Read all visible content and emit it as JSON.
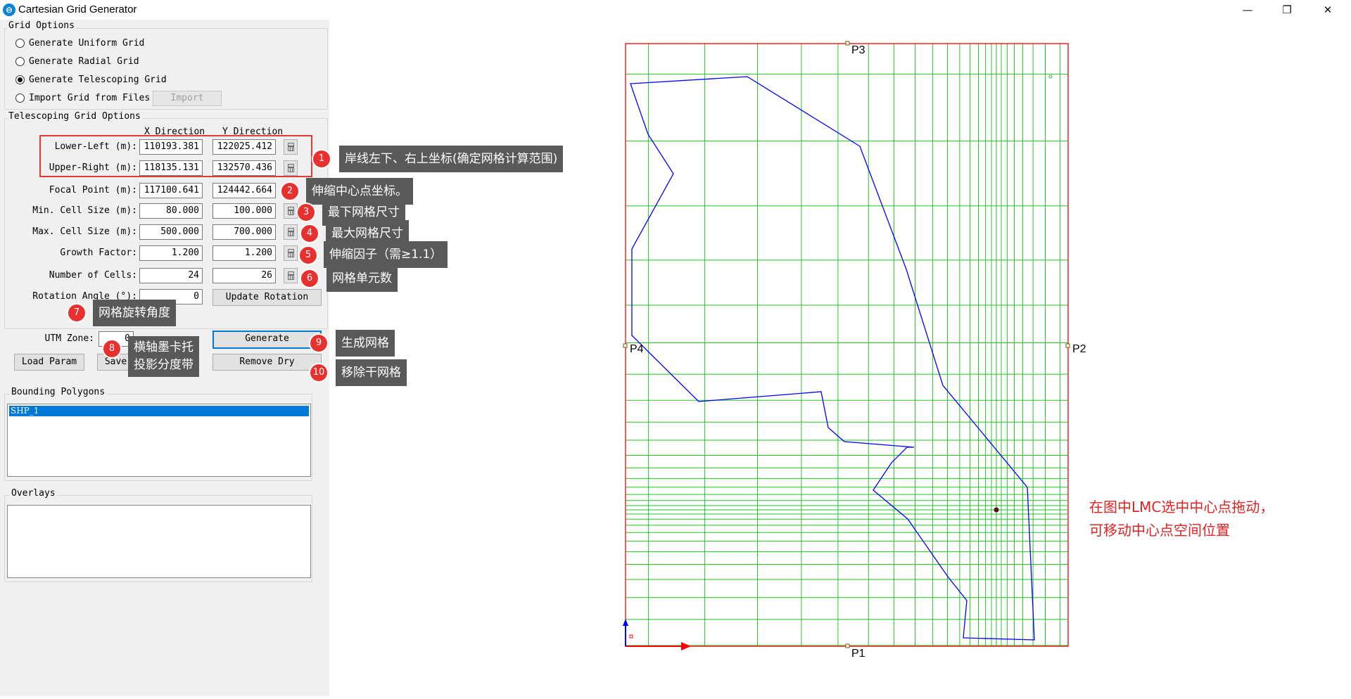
{
  "window": {
    "title": "Cartesian Grid Generator",
    "icon": "app-logo-icon",
    "controls": {
      "minimize": "—",
      "maximize": "❐",
      "close": "✕"
    }
  },
  "grid_options": {
    "title": "Grid Options",
    "options": [
      {
        "label": "Generate Uniform Grid",
        "checked": false
      },
      {
        "label": "Generate Radial Grid",
        "checked": false
      },
      {
        "label": "Generate Telescoping Grid",
        "checked": true
      },
      {
        "label": "Import Grid from Files",
        "checked": false
      }
    ],
    "import_label": "Import"
  },
  "telescoping": {
    "title": "Telescoping Grid Options",
    "x_header": "X Direction",
    "y_header": "Y Direction",
    "rows": [
      {
        "label": "Lower-Left (m):",
        "x": "110193.381",
        "y": "122025.412"
      },
      {
        "label": "Upper-Right (m):",
        "x": "118135.131",
        "y": "132570.436"
      },
      {
        "label": "Focal Point (m):",
        "x": "117100.641",
        "y": "124442.664"
      },
      {
        "label": "Min. Cell Size (m):",
        "x": "80.000",
        "y": "100.000"
      },
      {
        "label": "Max. Cell Size (m):",
        "x": "500.000",
        "y": "700.000"
      },
      {
        "label": "Growth Factor:",
        "x": "1.200",
        "y": "1.200"
      },
      {
        "label": "Number of Cells:",
        "x": "24",
        "y": "26"
      }
    ],
    "rotation_label": "Rotation Angle (°):",
    "rotation_value": "0",
    "update_rotation_label": "Update Rotation"
  },
  "utm": {
    "label": "UTM Zone:",
    "value": "0"
  },
  "buttons": {
    "generate": "Generate",
    "load_param": "Load Param",
    "save_param": "Save Param",
    "remove_dry": "Remove Dry"
  },
  "bounding_polygons": {
    "title": "Bounding Polygons",
    "items": [
      "SHP_1"
    ]
  },
  "overlays": {
    "title": "Overlays",
    "items": []
  },
  "callouts": [
    {
      "n": "1",
      "text": "岸线左下、右上坐标(确定网格计算范围)"
    },
    {
      "n": "2",
      "text": "伸缩中心点坐标。"
    },
    {
      "n": "3",
      "text": "最下网格尺寸"
    },
    {
      "n": "4",
      "text": "最大网格尺寸"
    },
    {
      "n": "5",
      "text": "伸缩因子（需≥1.1）"
    },
    {
      "n": "6",
      "text": "网格单元数"
    },
    {
      "n": "7",
      "text": "网格旋转角度"
    },
    {
      "n": "8",
      "text": "横轴墨卡托\n投影分度带"
    },
    {
      "n": "9",
      "text": "生成网格"
    },
    {
      "n": "10",
      "text": "移除干网格"
    }
  ],
  "canvas": {
    "points": [
      "P1",
      "P2",
      "P3",
      "P4"
    ],
    "hint_line1": "在图中LMC选中中心点拖动，",
    "hint_line2": "可移动中心点空间位置",
    "colors": {
      "boundary": "#ff0000",
      "grid": "#22c322",
      "polygon": "#0000ff",
      "focal": "#5a1010"
    }
  }
}
